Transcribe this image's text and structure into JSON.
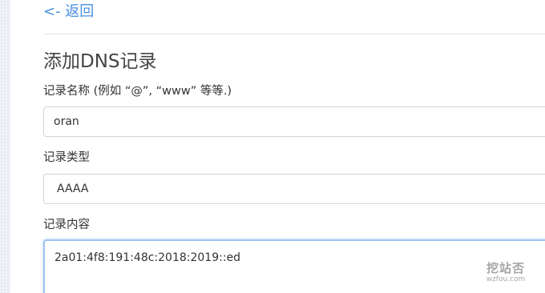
{
  "nav": {
    "back_label": "<- 返回"
  },
  "form": {
    "title": "添加DNS记录",
    "record_name": {
      "label": "记录名称 (例如 “@”, “www” 等等.)",
      "value": "oran"
    },
    "record_type": {
      "label": "记录类型",
      "selected": "AAAA"
    },
    "record_content": {
      "label": "记录内容",
      "value": "2a01:4f8:191:48c:2018:2019::ed"
    }
  },
  "watermark": {
    "main": "挖站否",
    "sub": "wzfou.com"
  },
  "colors": {
    "link": "#4a90e2",
    "focus_border": "#9cc2f0"
  }
}
